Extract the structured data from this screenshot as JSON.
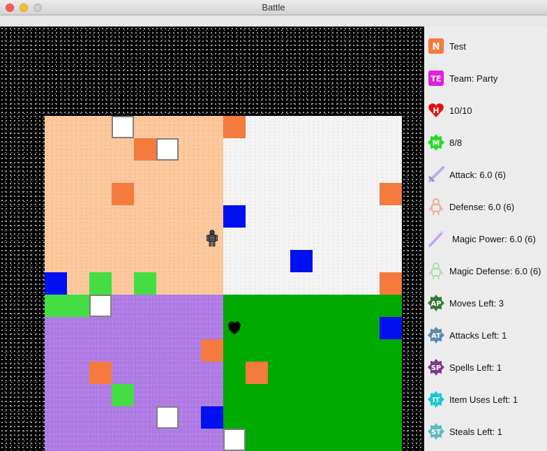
{
  "window": {
    "title": "Battle"
  },
  "board": {
    "tiles": [
      {
        "color": "white",
        "col": 3,
        "row": 0
      },
      {
        "color": "orange",
        "col": 8,
        "row": 0
      },
      {
        "color": "orange",
        "col": 4,
        "row": 1
      },
      {
        "color": "white",
        "col": 5,
        "row": 1
      },
      {
        "color": "orange",
        "col": 3,
        "row": 3
      },
      {
        "color": "orange",
        "col": 15,
        "row": 3
      },
      {
        "color": "blue",
        "col": 8,
        "row": 4
      },
      {
        "color": "blue",
        "col": 11,
        "row": 6
      },
      {
        "color": "blue",
        "col": 0,
        "row": 7
      },
      {
        "color": "lgreen",
        "col": 2,
        "row": 7
      },
      {
        "color": "lgreen",
        "col": 4,
        "row": 7
      },
      {
        "color": "orange",
        "col": 15,
        "row": 7
      },
      {
        "color": "lgreen",
        "col": 0,
        "row": 8
      },
      {
        "color": "lgreen",
        "col": 1,
        "row": 8
      },
      {
        "color": "white",
        "col": 2,
        "row": 8
      },
      {
        "color": "blue",
        "col": 15,
        "row": 9
      },
      {
        "color": "orange",
        "col": 7,
        "row": 10
      },
      {
        "color": "orange",
        "col": 2,
        "row": 11
      },
      {
        "color": "orange",
        "col": 9,
        "row": 11
      },
      {
        "color": "lgreen",
        "col": 3,
        "row": 12
      },
      {
        "color": "white",
        "col": 5,
        "row": 13
      },
      {
        "color": "blue",
        "col": 7,
        "row": 13
      },
      {
        "color": "white",
        "col": 8,
        "row": 14
      }
    ],
    "player": {
      "col": 7,
      "row": 5
    },
    "enemy": {
      "col": 8,
      "row": 9
    }
  },
  "stats": {
    "name": "Test",
    "team": "Team: Party",
    "hp": "10/10",
    "mp": "8/8",
    "attack": "Attack: 6.0 (6)",
    "defense": "Defense: 6.0 (6)",
    "magic_power": "Magic Power: 6.0 (6)",
    "magic_defense": "Magic Defense: 6.0 (6)",
    "moves_left": "Moves Left: 3",
    "attacks_left": "Attacks Left: 1",
    "spells_left": "Spells Left: 1",
    "item_uses_left": "Item Uses Left: 1",
    "steals_left": "Steals Left: 1"
  },
  "icons": {
    "name": {
      "name": "name-badge-icon",
      "text": "N",
      "color": "#f47a3e"
    },
    "team": {
      "name": "team-badge-icon",
      "text": "TE",
      "color": "#e020e0"
    },
    "hp": {
      "name": "heart-icon",
      "text": "H",
      "color": "#e01010"
    },
    "mp": {
      "name": "mana-badge-icon",
      "text": "M",
      "color": "#22dd22"
    },
    "attack": {
      "name": "sword-icon",
      "color": "#b0b0f0"
    },
    "defense": {
      "name": "armor-icon",
      "color": "#f4b0a0"
    },
    "magic_power": {
      "name": "wand-icon",
      "color": "#c8a0f0"
    },
    "magic_defense": {
      "name": "magic-armor-icon",
      "color": "#b0e8b0"
    },
    "moves": {
      "name": "ap-badge-icon",
      "text": "AP",
      "color": "#3a7a3a"
    },
    "attacks": {
      "name": "at-badge-icon",
      "text": "AT",
      "color": "#5a8ab0"
    },
    "spells": {
      "name": "sp-badge-icon",
      "text": "SP",
      "color": "#7a3a8a"
    },
    "items": {
      "name": "it-badge-icon",
      "text": "IT",
      "color": "#18c8d8"
    },
    "steals": {
      "name": "st-badge-icon",
      "text": "ST",
      "color": "#60b8c0"
    }
  }
}
